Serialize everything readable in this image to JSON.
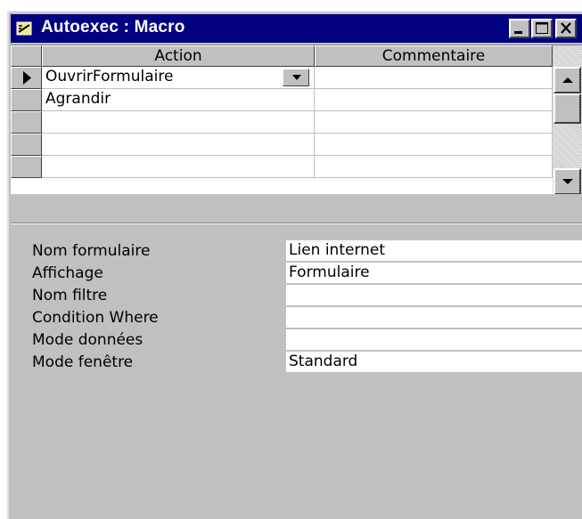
{
  "window": {
    "title": "Autoexec : Macro",
    "controls": {
      "minimize_icon": "minimize-icon",
      "maximize_icon": "maximize-icon",
      "close_icon": "close-icon"
    }
  },
  "grid": {
    "columns": [
      "Action",
      "Commentaire"
    ],
    "rows": [
      {
        "action": "OuvrirFormulaire",
        "comment": "",
        "current": true
      },
      {
        "action": "Agrandir",
        "comment": ""
      },
      {
        "action": "",
        "comment": ""
      },
      {
        "action": "",
        "comment": ""
      },
      {
        "action": "",
        "comment": ""
      }
    ]
  },
  "arguments": [
    {
      "label": "Nom formulaire",
      "value": "Lien internet"
    },
    {
      "label": "Affichage",
      "value": "Formulaire"
    },
    {
      "label": "Nom filtre",
      "value": ""
    },
    {
      "label": "Condition Where",
      "value": ""
    },
    {
      "label": "Mode données",
      "value": ""
    },
    {
      "label": "Mode fenêtre",
      "value": "Standard"
    }
  ],
  "colors": {
    "titlebar": "#000080",
    "face": "#c0c0c0",
    "cell": "#ffffff"
  }
}
